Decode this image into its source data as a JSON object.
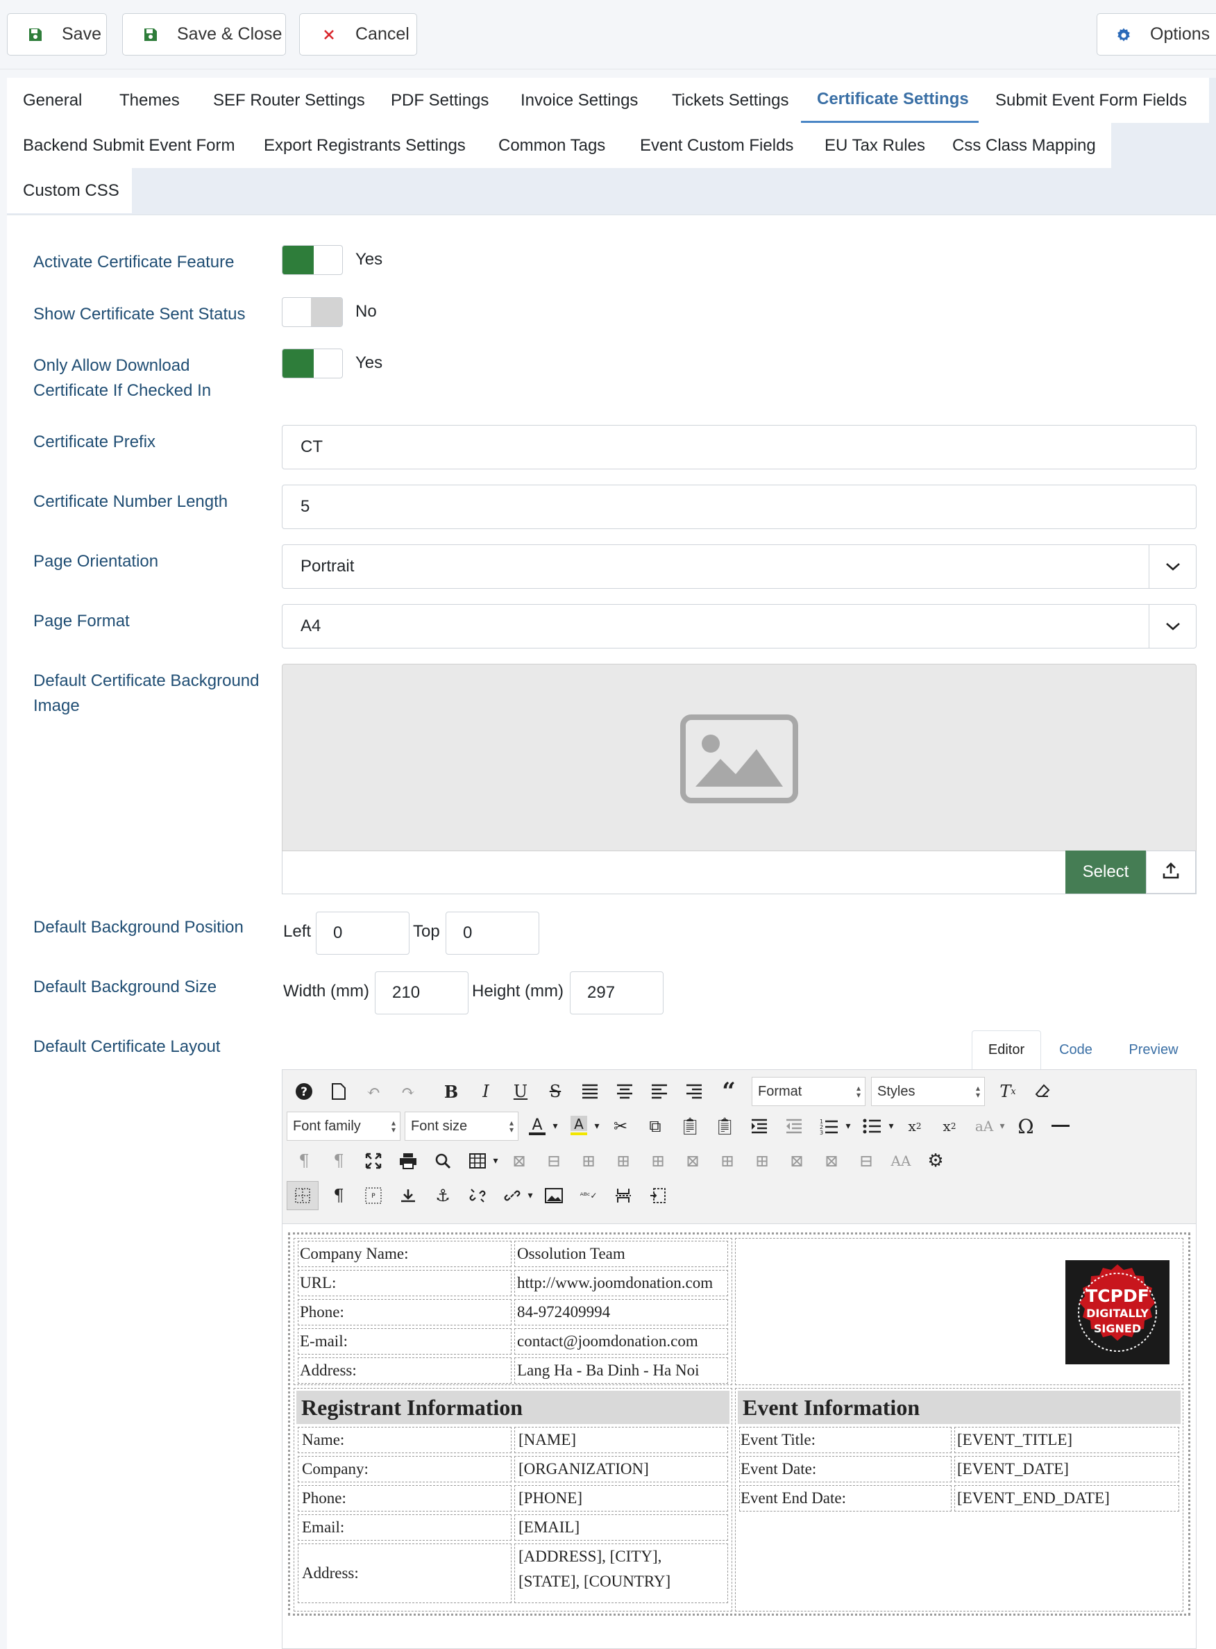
{
  "toolbar": {
    "save_label": "Save",
    "save_close_label": "Save & Close",
    "cancel_label": "Cancel",
    "options_label": "Options"
  },
  "tabs": [
    {
      "label": "General"
    },
    {
      "label": "Themes"
    },
    {
      "label": "SEF Router Settings"
    },
    {
      "label": "PDF Settings"
    },
    {
      "label": "Invoice Settings"
    },
    {
      "label": "Tickets Settings"
    },
    {
      "label": "Certificate Settings",
      "active": true
    },
    {
      "label": "Submit Event Form Fields"
    },
    {
      "label": "Backend Submit Event Form"
    },
    {
      "label": "Export Registrants Settings"
    },
    {
      "label": "Common Tags"
    },
    {
      "label": "Event Custom Fields"
    },
    {
      "label": "EU Tax Rules"
    },
    {
      "label": "Css Class Mapping"
    },
    {
      "label": "Custom CSS"
    }
  ],
  "form": {
    "activate": {
      "label": "Activate Certificate Feature",
      "state": "Yes"
    },
    "sent_status": {
      "label": "Show Certificate Sent Status",
      "state": "No"
    },
    "only_allow": {
      "label_line1": "Only Allow Download",
      "label_line2": "Certificate If Checked In",
      "state": "Yes"
    },
    "prefix": {
      "label": "Certificate Prefix",
      "value": "CT"
    },
    "number_length": {
      "label": "Certificate Number Length",
      "value": "5"
    },
    "orientation": {
      "label": "Page Orientation",
      "value": "Portrait"
    },
    "format": {
      "label": "Page Format",
      "value": "A4"
    },
    "bg_image": {
      "label_line1": "Default Certificate Background",
      "label_line2": "Image",
      "select_label": "Select"
    },
    "bg_position": {
      "label": "Default Background Position",
      "left_label": "Left",
      "left_value": "0",
      "top_label": "Top",
      "top_value": "0"
    },
    "bg_size": {
      "label": "Default Background Size",
      "width_label": "Width (mm)",
      "width_value": "210",
      "height_label": "Height (mm)",
      "height_value": "297"
    },
    "layout": {
      "label": "Default Certificate Layout"
    }
  },
  "editor": {
    "tabs": [
      "Editor",
      "Code",
      "Preview"
    ],
    "format_label": "Format",
    "styles_label": "Styles",
    "font_family_label": "Font family",
    "font_size_label": "Font size"
  },
  "certificate": {
    "company_rows": [
      {
        "label": "Company Name:",
        "value": "Ossolution Team"
      },
      {
        "label": "URL:",
        "value": "http://www.joomdonation.com"
      },
      {
        "label": "Phone:",
        "value": "84-972409994"
      },
      {
        "label": "E-mail:",
        "value": "contact@joomdonation.com"
      },
      {
        "label": "Address:",
        "value": "Lang Ha - Ba Dinh - Ha Noi"
      }
    ],
    "logo": {
      "line1": "TCPDF",
      "line2": "DIGITALLY",
      "line3": "SIGNED"
    },
    "registrant_title": "Registrant Information",
    "registrant_rows": [
      {
        "label": "Name:",
        "value": "[NAME]"
      },
      {
        "label": "Company:",
        "value": "[ORGANIZATION]"
      },
      {
        "label": "Phone:",
        "value": "[PHONE]"
      },
      {
        "label": "Email:",
        "value": "[EMAIL]"
      },
      {
        "label": "Address:",
        "value": "[ADDRESS], [CITY],",
        "value2": "[STATE], [COUNTRY]"
      }
    ],
    "event_title": "Event Information",
    "event_rows": [
      {
        "label": "Event Title:",
        "value": "[EVENT_TITLE]"
      },
      {
        "label": "Event Date:",
        "value": "[EVENT_DATE]"
      },
      {
        "label": "Event End Date:",
        "value": "[EVENT_END_DATE]"
      }
    ]
  }
}
